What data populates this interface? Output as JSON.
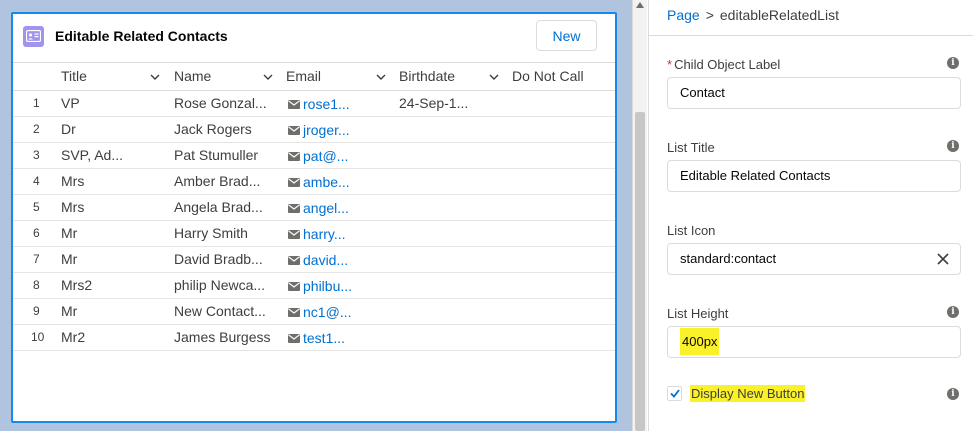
{
  "card": {
    "title": "Editable Related Contacts",
    "new_button": "New"
  },
  "columns": [
    "Title",
    "Name",
    "Email",
    "Birthdate",
    "Do Not Call"
  ],
  "rows": [
    {
      "num": "1",
      "title": "VP",
      "name": "Rose Gonzal...",
      "email": "rose1...",
      "birthdate": "24-Sep-1..."
    },
    {
      "num": "2",
      "title": "Dr",
      "name": "Jack Rogers",
      "email": "jroger...",
      "birthdate": ""
    },
    {
      "num": "3",
      "title": "SVP, Ad...",
      "name": "Pat Stumuller",
      "email": "pat@...",
      "birthdate": ""
    },
    {
      "num": "4",
      "title": "Mrs",
      "name": "Amber Brad...",
      "email": "ambe...",
      "birthdate": ""
    },
    {
      "num": "5",
      "title": "Mrs",
      "name": "Angela Brad...",
      "email": "angel...",
      "birthdate": ""
    },
    {
      "num": "6",
      "title": "Mr",
      "name": "Harry Smith",
      "email": "harry...",
      "birthdate": ""
    },
    {
      "num": "7",
      "title": "Mr",
      "name": "David Bradb...",
      "email": "david...",
      "birthdate": ""
    },
    {
      "num": "8",
      "title": "Mrs2",
      "name": "philip Newca...",
      "email": "philbu...",
      "birthdate": ""
    },
    {
      "num": "9",
      "title": "Mr",
      "name": "New Contact...",
      "email": "nc1@...",
      "birthdate": ""
    },
    {
      "num": "10",
      "title": "Mr2",
      "name": "James Burgess",
      "email": "test1...",
      "birthdate": ""
    }
  ],
  "panel": {
    "breadcrumb_page": "Page",
    "breadcrumb_sep": ">",
    "breadcrumb_current": "editableRelatedList",
    "child_object_label": "Child Object Label",
    "child_object_required": "*",
    "child_object_value": "Contact",
    "list_title_label": "List Title",
    "list_title_value": "Editable Related Contacts",
    "list_icon_label": "List Icon",
    "list_icon_value": "standard:contact",
    "list_height_label": "List Height",
    "list_height_value": "400px",
    "display_new_button_label": "Display New Button",
    "display_new_button_checked": true,
    "info_glyph": "i"
  },
  "colors": {
    "accent": "#1589ee",
    "link": "#0070d2",
    "card_icon": "#a094ed",
    "highlight": "#fbf12b"
  }
}
